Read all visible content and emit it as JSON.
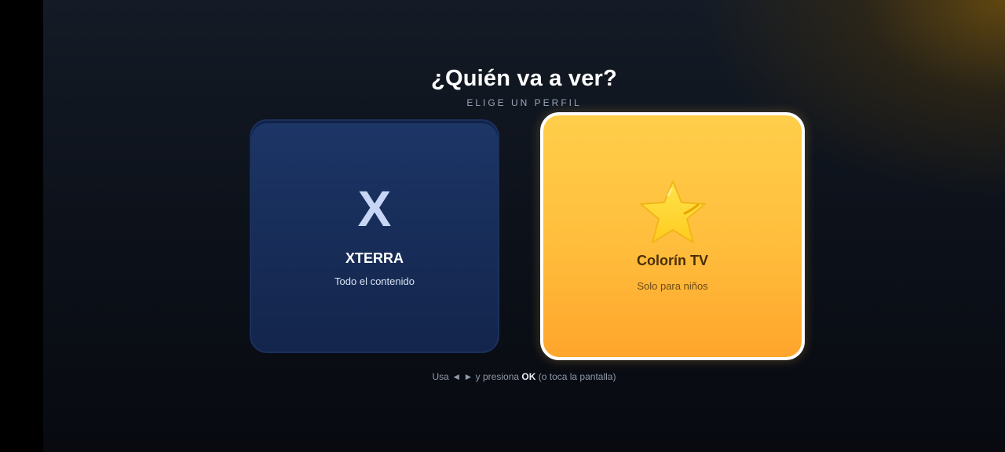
{
  "header": {
    "title": "¿Quién va a ver?",
    "subtitle": "ELIGE UN PERFIL"
  },
  "profiles": [
    {
      "icon_letter": "X",
      "name": "XTERRA",
      "description": "Todo el contenido",
      "color": "#1a3363"
    },
    {
      "icon": "star-icon",
      "name": "Colorín TV",
      "description": "Solo para niños",
      "color": "#ffbd3c",
      "selected": true
    }
  ],
  "hint": {
    "prefix": "Usa",
    "left_arrow": "◄",
    "right_arrow": "►",
    "middle": "y presiona",
    "ok": "OK",
    "suffix": "(o toca la pantalla)"
  },
  "colors": {
    "accent_focus": "#ffffff",
    "star": "#ffd23a"
  }
}
